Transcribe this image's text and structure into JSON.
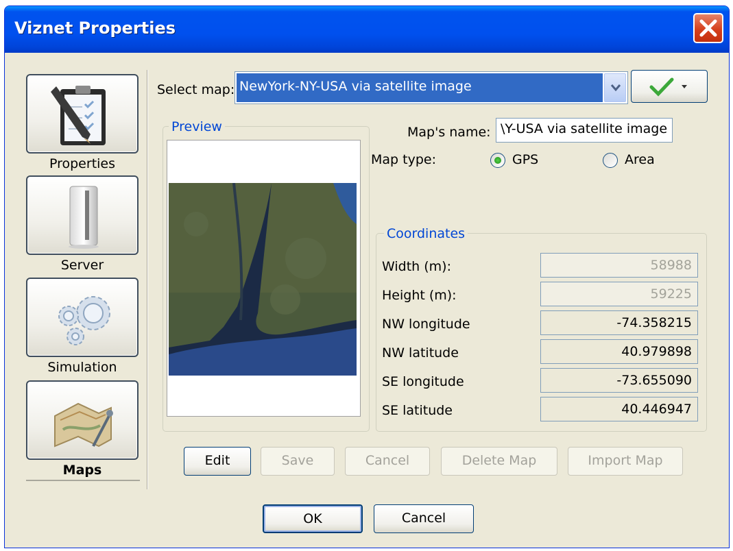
{
  "window": {
    "title": "Viznet Properties"
  },
  "sidebar": {
    "items": [
      {
        "label": "Properties",
        "icon": "clipboard-checklist-pencil-icon",
        "active": false
      },
      {
        "label": "Server",
        "icon": "server-tower-icon",
        "active": false
      },
      {
        "label": "Simulation",
        "icon": "gears-icon",
        "active": false
      },
      {
        "label": "Maps",
        "icon": "map-pin-icon",
        "active": true
      }
    ]
  },
  "select_map": {
    "label": "Select map:",
    "value": "NewYork-NY-USA via satellite image",
    "apply_icon": "check-icon"
  },
  "preview": {
    "title": "Preview",
    "image": "new-york-satellite-map-image"
  },
  "map_name": {
    "label": "Map's name:",
    "value": "\\Y-USA via satellite image"
  },
  "map_type": {
    "label": "Map type:",
    "options": [
      {
        "label": "GPS",
        "selected": true
      },
      {
        "label": "Area",
        "selected": false
      }
    ]
  },
  "coordinates": {
    "title": "Coordinates",
    "fields": [
      {
        "label": "Width (m):",
        "value": "58988",
        "readonly": true
      },
      {
        "label": "Height (m):",
        "value": "59225",
        "readonly": true
      },
      {
        "label": "NW longitude",
        "value": "-74.358215",
        "readonly": false
      },
      {
        "label": "NW latitude",
        "value": "40.979898",
        "readonly": false
      },
      {
        "label": "SE longitude",
        "value": "-73.655090",
        "readonly": false
      },
      {
        "label": "SE latitude",
        "value": "40.446947",
        "readonly": false
      }
    ]
  },
  "map_actions": {
    "edit": "Edit",
    "save": "Save",
    "cancel": "Cancel",
    "delete": "Delete Map",
    "import": "Import Map"
  },
  "dialog_actions": {
    "ok": "OK",
    "cancel": "Cancel"
  },
  "colors": {
    "titlebar": "#0053ee",
    "dialog_bg": "#ece9d8",
    "selection": "#316ac5",
    "group_title": "#0046d5",
    "close_button": "#d6401c"
  }
}
